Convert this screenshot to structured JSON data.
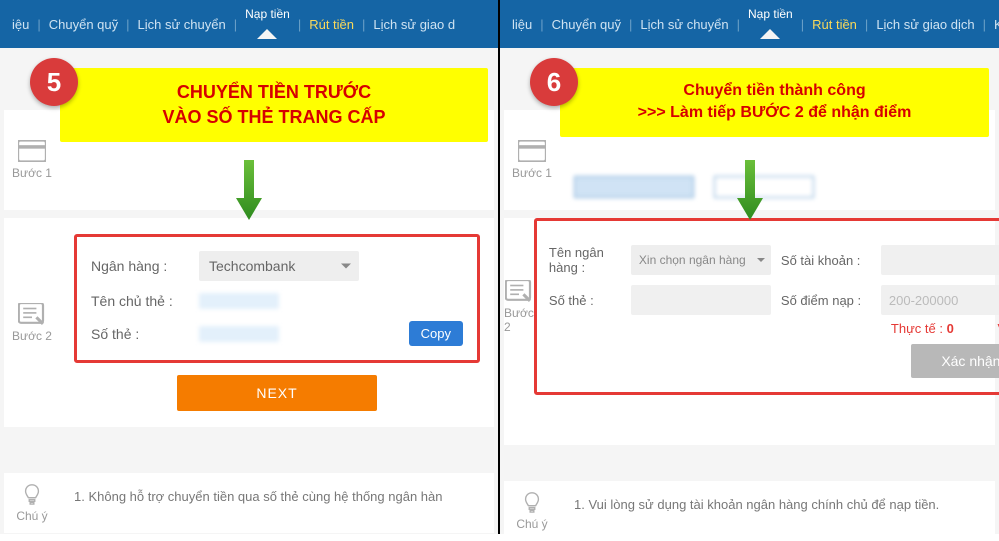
{
  "nav": {
    "items": [
      "iệu",
      "Chuyển quỹ",
      "Lịch sử chuyển",
      "Nạp tiền",
      "Rút tiền",
      "Lịch sử giao dịch"
    ],
    "napTien": "Nạp tiền",
    "rutTien": "Rút tiền",
    "chuyenQuy": "Chuyển quỹ",
    "lichSuChuyen": "Lịch sử chuyển",
    "ieu": "iệu",
    "lichSuGiao": "Lịch sử giao d",
    "lieu": "liệu",
    "lichSuGiaoDich": "Lịch sử giao dịch",
    "khuyenMai": "Khuyến mãi"
  },
  "left": {
    "badge": "5",
    "callout1": "CHUYỂN TIỀN TRƯỚC",
    "callout2": "VÀO SỐ THẺ TRANG CẤP",
    "step1": "Bước 1",
    "step2": "Bước 2",
    "chuY": "Chú ý",
    "fields": {
      "nganHang": "Ngân hàng :",
      "bankValue": "Techcombank",
      "tenChuThe": "Tên chủ thẻ :",
      "soThe": "Số thẻ :",
      "copy": "Copy",
      "next": "NEXT"
    },
    "note": "1.  Không hỗ trợ chuyển tiền qua số thẻ cùng hệ thống ngân hàn"
  },
  "right": {
    "badge": "6",
    "callout1": "Chuyển tiền thành công",
    "callout2": ">>> Làm tiếp BƯỚC 2 để nhận điểm",
    "step1": "Bước 1",
    "step2": "Bước 2",
    "chuY": "Chú ý",
    "fields": {
      "tenNganHang": "Tên ngân hàng :",
      "bankPlaceholder": "Xin chọn ngân hàng",
      "soTaiKhoan": "Số tài khoản :",
      "soThe": "Số thẻ :",
      "soDiemNap": "Số điểm nạp :",
      "rangePlaceholder": "200-200000",
      "thucTeLabel": "Thực tế :",
      "thucTeValue": "0",
      "currency": "VNĐ",
      "confirm": "Xác nhận"
    },
    "note": "1.  Vui lòng sử dụng tài khoản ngân hàng chính chủ để nạp tiền."
  }
}
